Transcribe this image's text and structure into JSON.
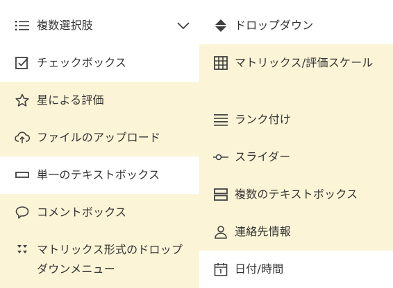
{
  "left_column": {
    "items": [
      {
        "label": "複数選択肢",
        "icon": "list-icon",
        "highlighted": false,
        "selected": true
      },
      {
        "label": "チェックボックス",
        "icon": "checkbox-icon",
        "highlighted": false
      },
      {
        "label": "星による評価",
        "icon": "star-icon",
        "highlighted": true
      },
      {
        "label": "ファイルのアップロード",
        "icon": "cloud-upload-icon",
        "highlighted": true
      },
      {
        "label": "単一のテキストボックス",
        "icon": "single-textbox-icon",
        "highlighted": false
      },
      {
        "label": "コメントボックス",
        "icon": "comment-icon",
        "highlighted": true
      },
      {
        "label": "マトリックス形式のドロップダウンメニュー",
        "icon": "matrix-dropdown-icon",
        "highlighted": true
      }
    ]
  },
  "right_column": {
    "items": [
      {
        "label": "ドロップダウン",
        "icon": "dropdown-icon",
        "highlighted": false
      },
      {
        "label": "マトリックス/評価スケール",
        "icon": "matrix-grid-icon",
        "highlighted": true
      },
      {
        "label": "ランク付け",
        "icon": "ranking-icon",
        "highlighted": true
      },
      {
        "label": "スライダー",
        "icon": "slider-icon",
        "highlighted": true
      },
      {
        "label": "複数のテキストボックス",
        "icon": "multiple-textbox-icon",
        "highlighted": true
      },
      {
        "label": "連絡先情報",
        "icon": "contact-icon",
        "highlighted": true
      },
      {
        "label": "日付/時間",
        "icon": "calendar-icon",
        "highlighted": false
      }
    ]
  },
  "colors": {
    "highlight": "#fcf4d6",
    "text": "#333333",
    "icon": "#404040"
  }
}
